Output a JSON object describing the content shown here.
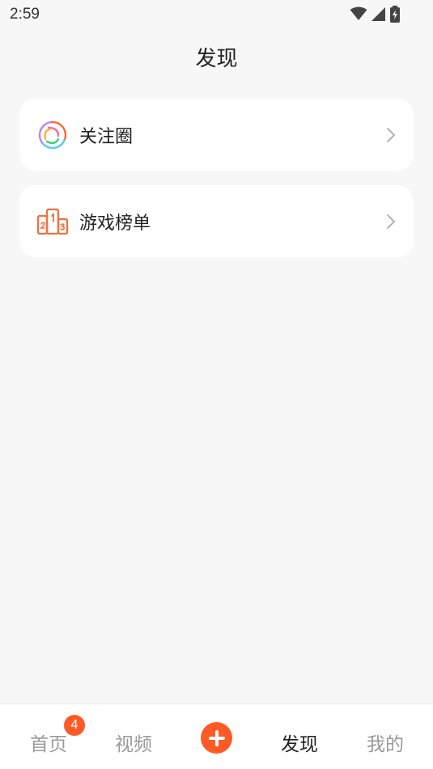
{
  "status_bar": {
    "time": "2:59",
    "icons": [
      "wifi-icon",
      "cellular-signal-icon",
      "battery-charging-icon"
    ]
  },
  "page": {
    "title": "发现"
  },
  "menu": {
    "items": [
      {
        "label": "关注圈",
        "icon": "follow-circle-icon"
      },
      {
        "label": "游戏榜单",
        "icon": "game-ranking-icon"
      }
    ]
  },
  "bottom_nav": {
    "items": [
      {
        "label": "首页",
        "active": false
      },
      {
        "label": "视频",
        "active": false
      },
      {
        "label": "发现",
        "active": true
      },
      {
        "label": "我的",
        "active": false
      }
    ],
    "home_badge": "4",
    "add_icon": "plus-icon"
  },
  "colors": {
    "accent": "#ff5a26",
    "background": "#f7f7f7",
    "card": "#ffffff",
    "inactive_text": "#999999"
  }
}
